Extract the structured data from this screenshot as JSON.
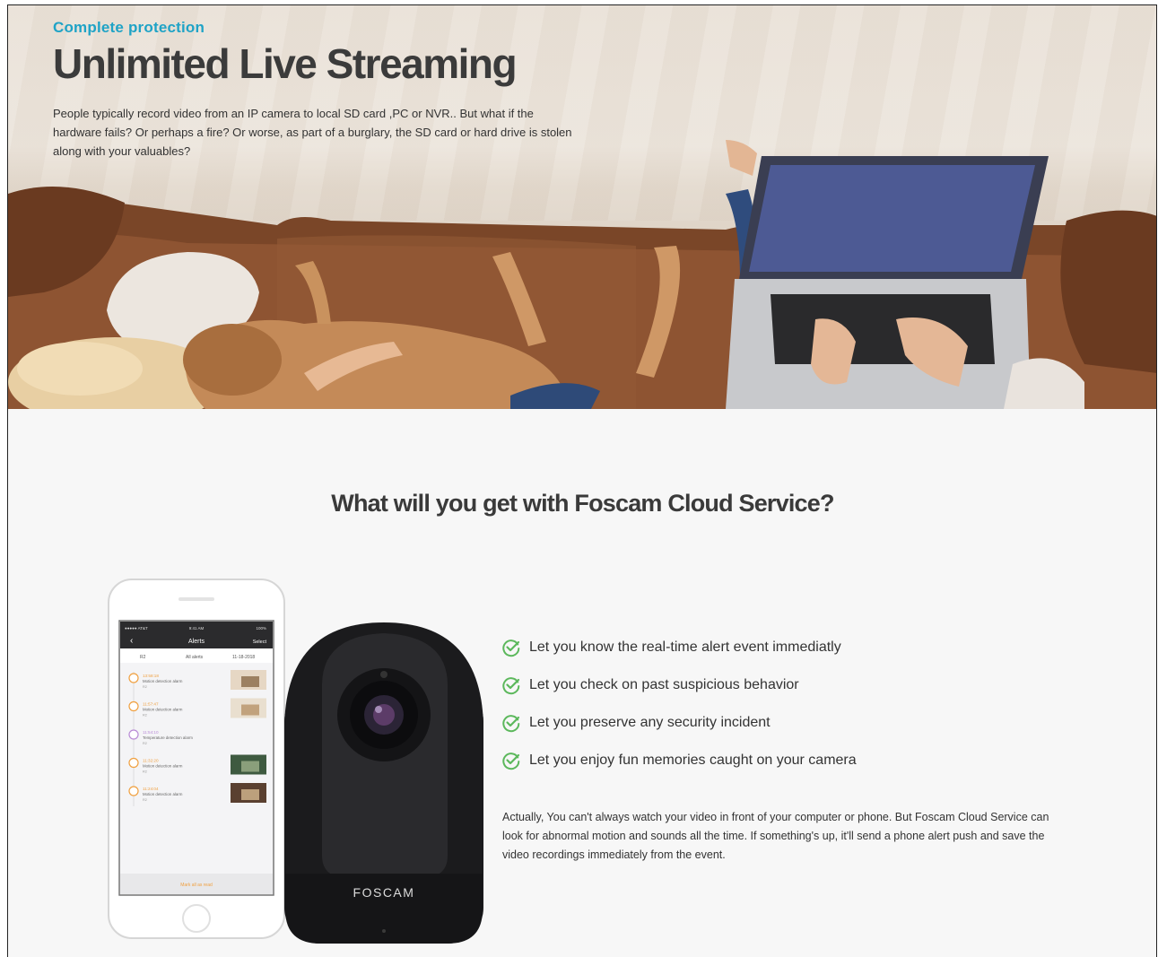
{
  "hero": {
    "eyebrow": "Complete protection",
    "title": "Unlimited Live Streaming",
    "description": "People typically record video from an IP camera to local SD card ,PC or NVR.. But what if the hardware fails? Or perhaps a fire? Or worse, as part of a burglary, the SD card or hard drive is stolen along with your valuables?"
  },
  "section": {
    "title": "What will you get with Foscam Cloud Service?",
    "features": [
      {
        "text": "Let you know the real-time alert event immediatly",
        "icon": "check-circle-icon"
      },
      {
        "text": "Let you check on past suspicious behavior",
        "icon": "check-circle-icon"
      },
      {
        "text": "Let you preserve any security incident",
        "icon": "check-circle-icon"
      },
      {
        "text": "Let you enjoy fun memories caught on your camera",
        "icon": "check-circle-icon"
      }
    ],
    "note": "Actually, You can't always watch your video in front of your computer or phone. But Foscam Cloud Service can look for abnormal motion and sounds all the time. If something's up, it'll send a phone alert push and save the video recordings immediately from the event."
  },
  "phone": {
    "status_carrier": "●●●●● AT&T",
    "status_time": "9:41 AM",
    "status_battery": "100%",
    "nav_title": "Alerts",
    "nav_action": "Select",
    "filter_camera": "R2",
    "filter_type": "All alerts",
    "filter_date": "11-18-2018",
    "alerts": [
      {
        "time": "13:58:18",
        "label": "Motion detection alarm",
        "cam": "R2"
      },
      {
        "time": "11:57:47",
        "label": "Motion detection alarm",
        "cam": "R2"
      },
      {
        "time": "11:54:10",
        "label": "Temperature detection alarm",
        "cam": "R2"
      },
      {
        "time": "11:32:20",
        "label": "Motion detection alarm",
        "cam": "R2"
      },
      {
        "time": "11:24:04",
        "label": "Motion detection alarm",
        "cam": "R2"
      }
    ],
    "footer": "Mark all as read"
  },
  "camera": {
    "brand": "FOSCAM"
  },
  "colors": {
    "accent_blue": "#1fa3c6",
    "check_green": "#5cb85c",
    "alert_orange": "#f0a040",
    "alert_purple": "#b98bd6"
  }
}
